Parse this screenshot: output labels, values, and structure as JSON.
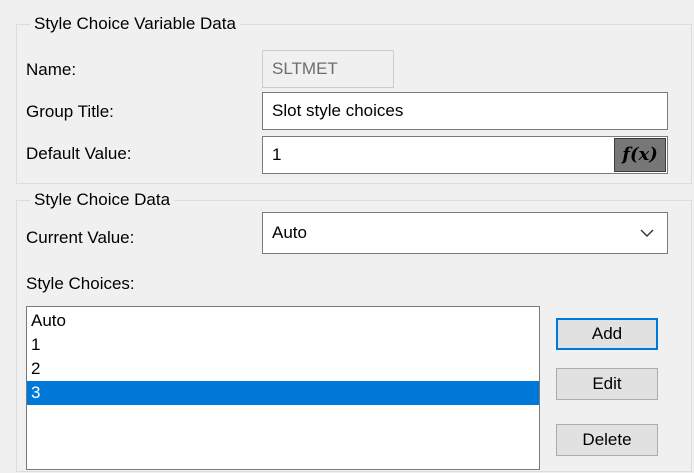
{
  "variable_group": {
    "legend": "Style Choice Variable Data",
    "name_label": "Name:",
    "name_value": "SLTMET",
    "group_title_label": "Group Title:",
    "group_title_value": "Slot style choices",
    "default_value_label": "Default Value:",
    "default_value_value": "1",
    "fx_button": "f(x)"
  },
  "choice_group": {
    "legend": "Style Choice Data",
    "current_value_label": "Current Value:",
    "current_value_selected": "Auto",
    "style_choices_label": "Style Choices:",
    "style_choices": [
      "Auto",
      "1",
      "2",
      "3"
    ],
    "selected_choice": "3",
    "add_label": "Add",
    "edit_label": "Edit",
    "delete_label": "Delete"
  },
  "colors": {
    "selection": "#0078d7",
    "background": "#f0f0f0"
  }
}
